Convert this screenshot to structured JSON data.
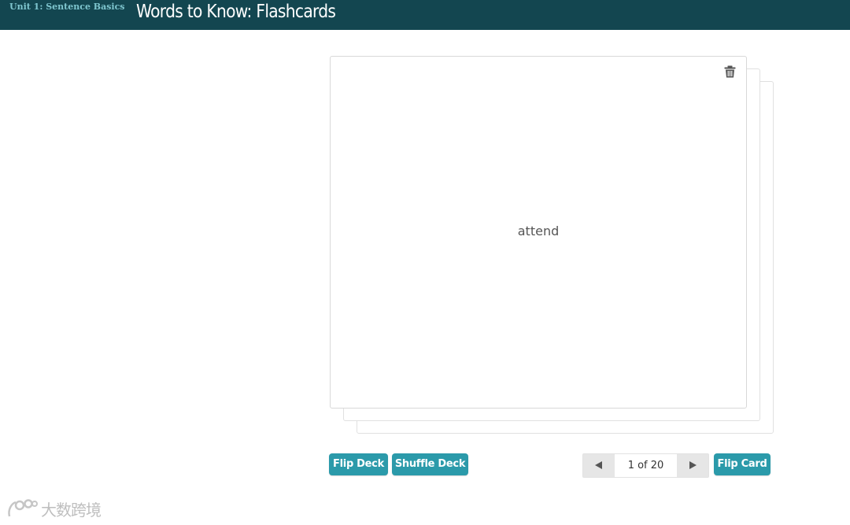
{
  "header": {
    "unit_label": "Unit 1: Sentence Basics",
    "title": "Words to Know: Flashcards"
  },
  "card": {
    "word": "attend",
    "delete_icon": "trash-icon"
  },
  "controls": {
    "flip_deck_label": "Flip Deck",
    "shuffle_deck_label": "Shuffle Deck",
    "pager_text": "1 of 20",
    "flip_card_label": "Flip Card",
    "prev_icon": "triangle-left-icon",
    "next_icon": "triangle-right-icon"
  },
  "watermark": {
    "text": "大数跨境"
  },
  "colors": {
    "header_bg": "#134650",
    "unit_label": "#7fc6cf",
    "button_bg": "#2b9aaa"
  }
}
